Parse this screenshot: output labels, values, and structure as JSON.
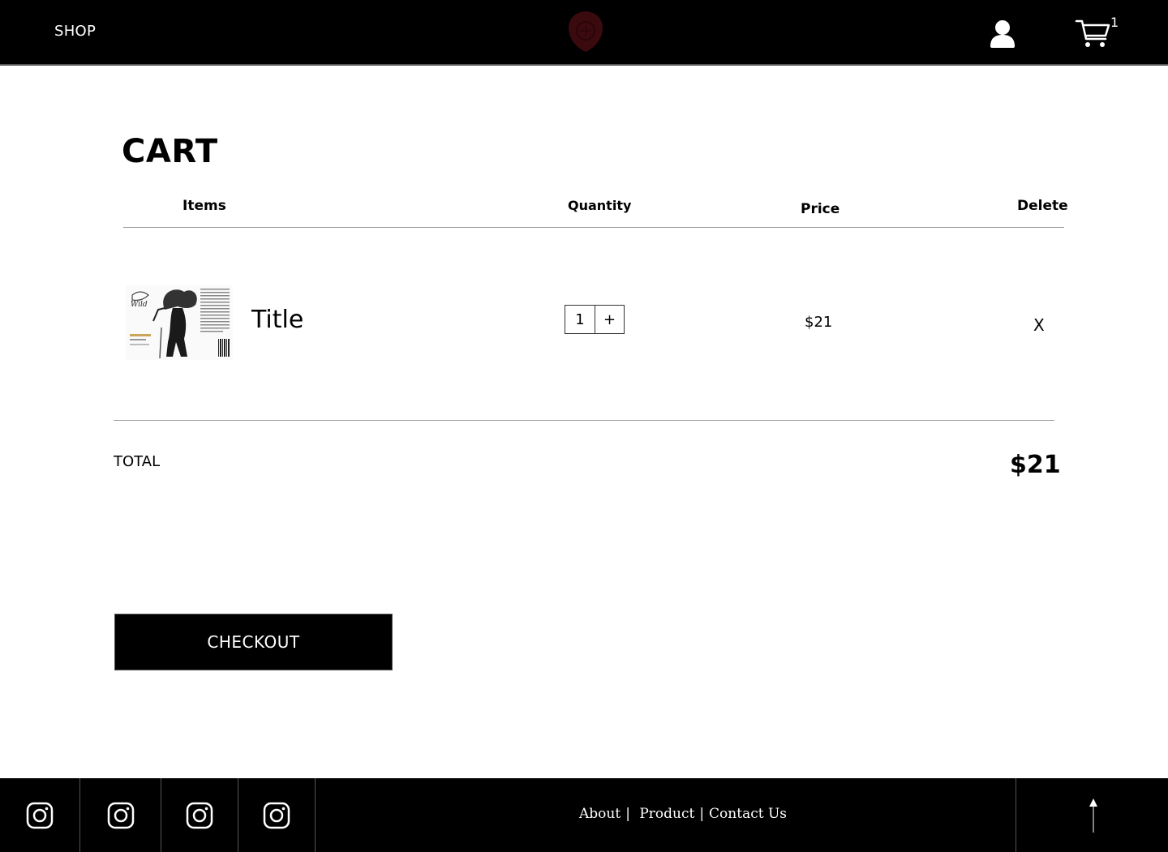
{
  "header": {
    "shop_label": "SHOP",
    "cart_count": "1",
    "icons": {
      "logo": "shield-logo",
      "user": "user-icon",
      "cart": "shopping-cart-icon"
    },
    "colors": {
      "background": "#000000",
      "logo_color": "#3a0a0f"
    }
  },
  "cart": {
    "title": "CART",
    "columns": {
      "items": "Items",
      "quantity": "Quantity",
      "price": "Price",
      "delete": "Delete"
    },
    "items": [
      {
        "title": "Title",
        "quantity": "1",
        "increment_label": "+",
        "price": "$21",
        "delete_label": "X"
      }
    ],
    "total_label": "TOTAL",
    "total_value": "$21",
    "checkout_label": "CHECKOUT"
  },
  "footer": {
    "social_icons": [
      "instagram-icon",
      "instagram-icon",
      "instagram-icon",
      "instagram-icon"
    ],
    "links": {
      "about": "About",
      "product": "Product",
      "contact": "Contact Us",
      "separator": "|"
    },
    "back_to_top_icon": "arrow-up-icon"
  }
}
